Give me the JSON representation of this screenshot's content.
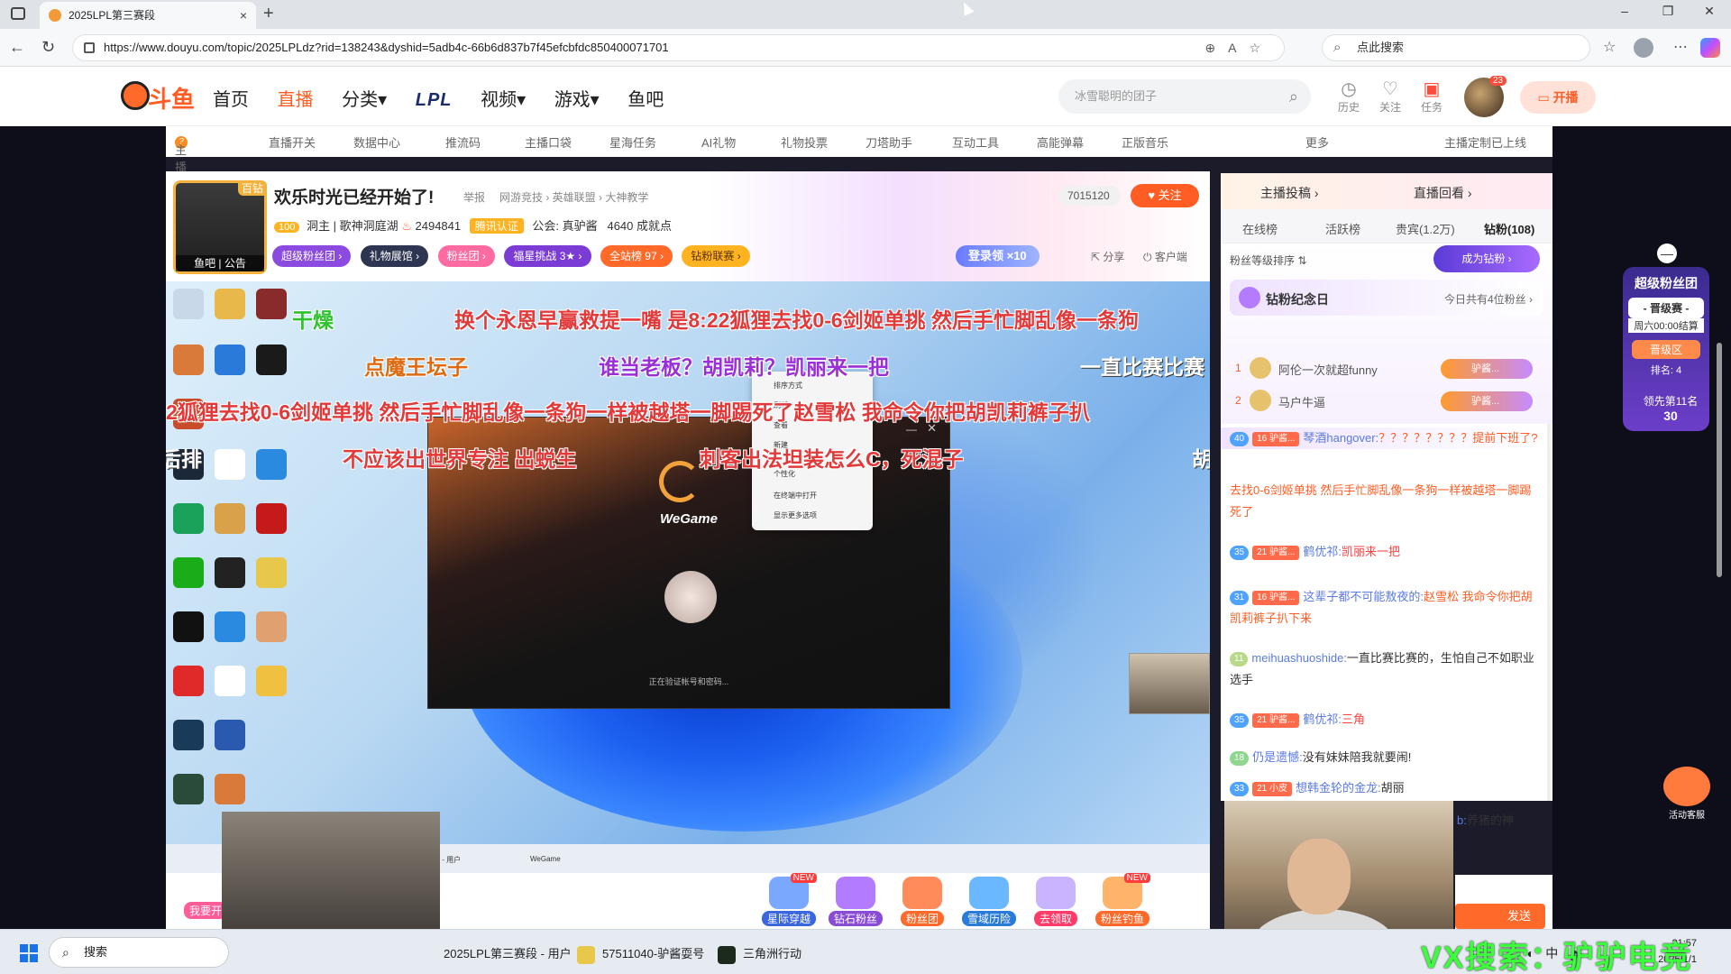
{
  "browser": {
    "tab_title": "2025LPL第三赛段",
    "url": "https://www.douyu.com/topic/2025LPLdz?rid=138243&dyshid=5adb4c-66b6d837b7f45efcbfdc850400071701",
    "search_placeholder": "点此搜索",
    "new_tab": "+",
    "tab_close": "×",
    "min": "–",
    "restore": "❐",
    "close": "✕"
  },
  "site": {
    "logo_text": "斗鱼",
    "nav": [
      "首页",
      "直播",
      "分类▾",
      "LPL",
      "视频▾",
      "游戏▾",
      "鱼吧"
    ],
    "search_placeholder": "冰雪聪明的团子",
    "history": "历史",
    "follow": "关注",
    "task": "任务",
    "avatar_badge": "23",
    "start_live": "开播"
  },
  "subnav": [
    "主播积分",
    "直播开关",
    "数据中心",
    "推流码",
    "主播口袋",
    "星海任务",
    "AI礼物",
    "礼物投票",
    "刀塔助手",
    "互动工具",
    "高能弹幕",
    "正版音乐",
    "更多",
    "主播定制已上线"
  ],
  "room": {
    "avatar_tag": "百钻",
    "avatar_footer": "鱼吧 | 公告",
    "title": "欢乐时光已经开始了!",
    "report": "举报",
    "breadcrumb": "网游竞技 › 英雄联盟 › 大神教学",
    "level": "100",
    "host": "洞主 | 歌神洞庭湖",
    "hot": "2494841",
    "auth": "腾讯认证",
    "guild": "公会: 真驴酱",
    "points": "4640 成就点",
    "follow_count": "7015120",
    "follow_btn": "关注",
    "pills": [
      "超级粉丝团 ›",
      "礼物展馆 ›",
      "粉丝团 ›",
      "福星挑战 3★ ›",
      "全站榜 97 ›",
      "钻粉联赛 ›"
    ],
    "login_reward": "登录领 ×10",
    "share": "分享",
    "client": "客户端"
  },
  "danmaku": [
    {
      "text": "干燥",
      "color": "#2ec22e"
    },
    {
      "text": "换个永恩早赢救提一嘴 是8:22狐狸去找0-6剑姬单挑 然后手忙脚乱像一条狗",
      "color": "#e23a3a"
    },
    {
      "text": "点魔王坛子",
      "color": "#e06a10"
    },
    {
      "text": "谁当老板？胡凯莉？凯丽来一把",
      "color": "#9b2fd6"
    },
    {
      "text": "一直比赛比赛",
      "color": "#ffffff"
    },
    {
      "text": "2狐狸去找0-6剑姬单挑 然后手忙脚乱像一条狗一样被越塔一脚踢死了赵雪松 我命令你把胡凯莉裤子扒",
      "color": "#e23a3a"
    },
    {
      "text": "后排",
      "color": "#ffffff"
    },
    {
      "text": "不应该出世界专注 出蜕生",
      "color": "#e23a3a"
    },
    {
      "text": "刺客出法坦装怎么C，死混子",
      "color": "#e23a3a"
    },
    {
      "text": "胡",
      "color": "#ffffff"
    }
  ],
  "wegame": {
    "name": "WeGame",
    "status": "正在验证帐号和密码...",
    "menu": [
      "排序方式",
      "刷新",
      "查看",
      "新建",
      "个性化",
      "在终端中打开",
      "显示更多选项"
    ]
  },
  "video_bar": {
    "item1": "2025LPL第三赛段 - 用户",
    "item2": "WeGame"
  },
  "gifts": [
    {
      "label": "星际穿越",
      "new": "NEW"
    },
    {
      "label": "钻石粉丝",
      "new": ""
    },
    {
      "label": "粉丝团",
      "new": ""
    },
    {
      "label": "雪域历险",
      "new": ""
    },
    {
      "label": "去领取",
      "new": ""
    },
    {
      "label": "粉丝钓鱼",
      "new": "NEW"
    }
  ],
  "gift_woyao": "我要开",
  "sidebar": {
    "top_left": "主播投稿 ›",
    "top_right": "直播回看 ›",
    "tabs": [
      "在线榜",
      "活跃榜",
      "贵宾(1.2万)",
      "钻粉(108)"
    ],
    "fan_sort": "粉丝等级排序 ⇅",
    "be_diamond": "成为钻粉 ›",
    "anniv_title": "钻粉纪念日",
    "anniv_count": "今日共有4位粉丝 ›",
    "fans": [
      {
        "rank": "1",
        "name": "阿伦一次就超funny",
        "badge": "驴酱..."
      },
      {
        "rank": "2",
        "name": "马户牛逼",
        "badge": "驴酱..."
      }
    ]
  },
  "chat": [
    {
      "lv": "40",
      "bdg": "16 驴酱...",
      "user": "琴酒hangover:",
      "text": "？？？？？？？？提前下班了?",
      "hl": true
    },
    {
      "lv": "",
      "bdg": "",
      "user": "",
      "text": "去找0-6剑姬单挑 然后手忙脚乱像一条狗一样被越塔一脚踢死了",
      "hl": false
    },
    {
      "lv": "35",
      "bdg": "21 驴酱...",
      "user": "鹤优祁:",
      "text": "凯丽来一把",
      "hl": false
    },
    {
      "lv": "31",
      "bdg": "16 驴酱...",
      "user": "这辈子都不可能敖夜的:",
      "text": "赵雪松 我命令你把胡凯莉裤子扒下来",
      "hl": false
    },
    {
      "lv": "11",
      "bdg": "",
      "user": "meihuashuoshide:",
      "text": "一直比赛比赛的，生怕自己不如职业选手",
      "hl": false
    },
    {
      "lv": "35",
      "bdg": "21 驴酱...",
      "user": "鹤优祁:",
      "text": "三角",
      "hl": false
    },
    {
      "lv": "18",
      "bdg": "",
      "user": "仍是遗憾:",
      "text": "没有妹妹陪我就要闹!",
      "hl": false
    },
    {
      "lv": "33",
      "bdg": "21 小皮",
      "user": "想韩金轮的金龙:",
      "text": "胡丽",
      "hl": false
    },
    {
      "lv": "",
      "bdg": "",
      "user": "b:",
      "text": "养猪的神",
      "hl": false
    }
  ],
  "send": "发送",
  "float": {
    "title": "超级粉丝团",
    "stage": "- 晋级赛 -",
    "deadline": "周六00:00结算",
    "zone": "晋级区",
    "rank": "排名: 4",
    "lead": "领先第11名",
    "lead_num": "30",
    "service": "活动客服"
  },
  "taskbar": {
    "search": "搜索",
    "apps": [
      "2025LPL第三赛段 - 用户",
      "57511040-驴酱耍号",
      "三角洲行动"
    ],
    "ime": "中",
    "time": "21:57",
    "date": "2025/1/1"
  },
  "watermark": "VX搜索：驴驴电竞"
}
